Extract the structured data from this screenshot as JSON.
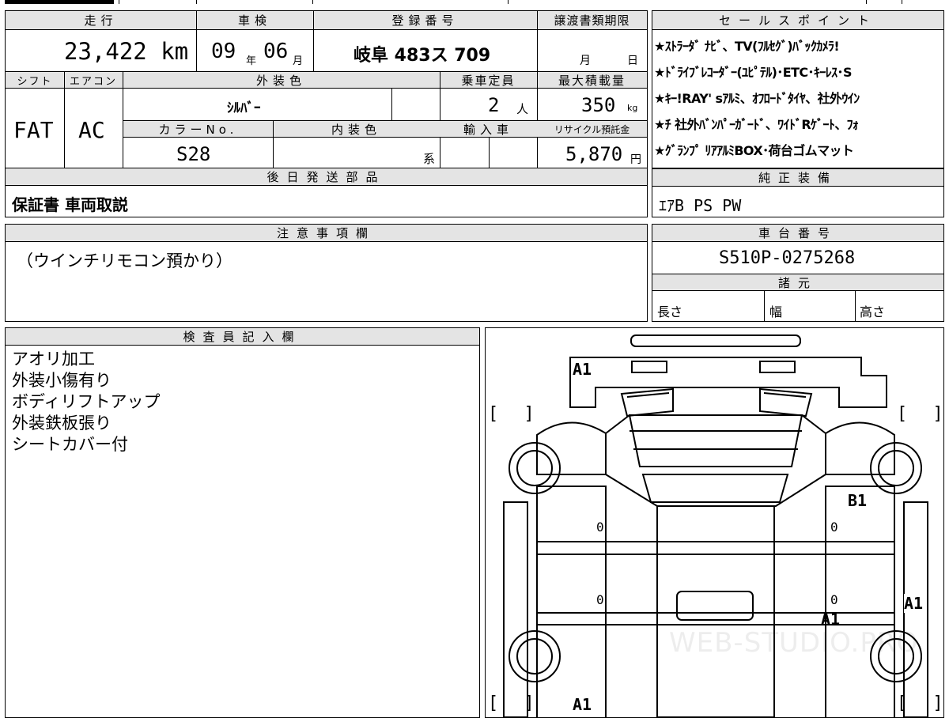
{
  "headers": {
    "mileage": "走行",
    "inspection": "車検",
    "registration": "登録番号",
    "transfer_deadline": "譲渡書類期限",
    "sales_points": "セールスポイント",
    "shift": "シフト",
    "aircon": "エアコン",
    "exterior_color": "外装色",
    "capacity": "乗車定員",
    "max_load": "最大積載量",
    "color_no": "カラーNo.",
    "interior_color": "内装色",
    "import": "輸入車",
    "recycle": "リサイクル預託金",
    "later_parts": "後日発送部品",
    "genuine_equipment": "純正装備",
    "notes": "注意事項欄",
    "chassis_no": "車台番号",
    "specs": "諸元",
    "inspector": "検査員記入欄"
  },
  "values": {
    "mileage": "23,422 km",
    "inspection_year": "09",
    "year_unit": "年",
    "inspection_month": "06",
    "month_unit": "月",
    "registration": "岐阜 483ス 709",
    "deadline_month": "月",
    "deadline_day": "日",
    "shift": "FAT",
    "aircon": "AC",
    "exterior_color": "ｼﾙﾊﾞｰ",
    "capacity": "2",
    "capacity_unit": "人",
    "max_load": "350",
    "load_unit": "kg",
    "color_no": "S28",
    "interior_suffix": "系",
    "recycle": "5,870",
    "recycle_unit": "円",
    "later_parts": "保証書 車両取説",
    "genuine_equipment": "ｴｱB PS PW",
    "notes": "（ウインチリモコン預かり）",
    "chassis_no": "S510P-0275268",
    "length": "長さ",
    "width": "幅",
    "height": "高さ"
  },
  "sales_points": [
    "★ｽﾄﾗｰﾀﾞ ﾅﾋﾞ、TV(ﾌﾙｾｸﾞ)ﾊﾞｯｸｶﾒﾗ!",
    "★ﾄﾞﾗｲﾌﾞﾚｺｰﾀﾞｰ(ﾕﾋﾟﾃﾙ)･ETC･ｷｰﾚｽ･S",
    "★ｷｰ!RAY' sｱﾙﾐ、ｵﾌﾛｰﾄﾞﾀｲﾔ、社外ｳｲﾝ",
    "★ﾁ 社外ﾊﾞﾝﾊﾟｰｶﾞｰﾄﾞ、ﾜｲﾄﾞRｹﾞｰﾄ、ﾌｫ",
    "★ｸﾞﾗﾝﾌﾟ ﾘｱｱﾙﾐBOX･荷台ゴムマット"
  ],
  "inspector_notes": [
    "アオリ加工",
    "外装小傷有り",
    "ボディリフトアップ",
    "外装鉄板張り",
    "シートカバー付"
  ],
  "diagram": {
    "marks": [
      "A1",
      "B1",
      "0",
      "0",
      "0",
      "0",
      "A1",
      "A1",
      "A1"
    ],
    "bracket_open": "[",
    "bracket_close": "]",
    "watermark": "WEB-STUDIO.PRO"
  }
}
